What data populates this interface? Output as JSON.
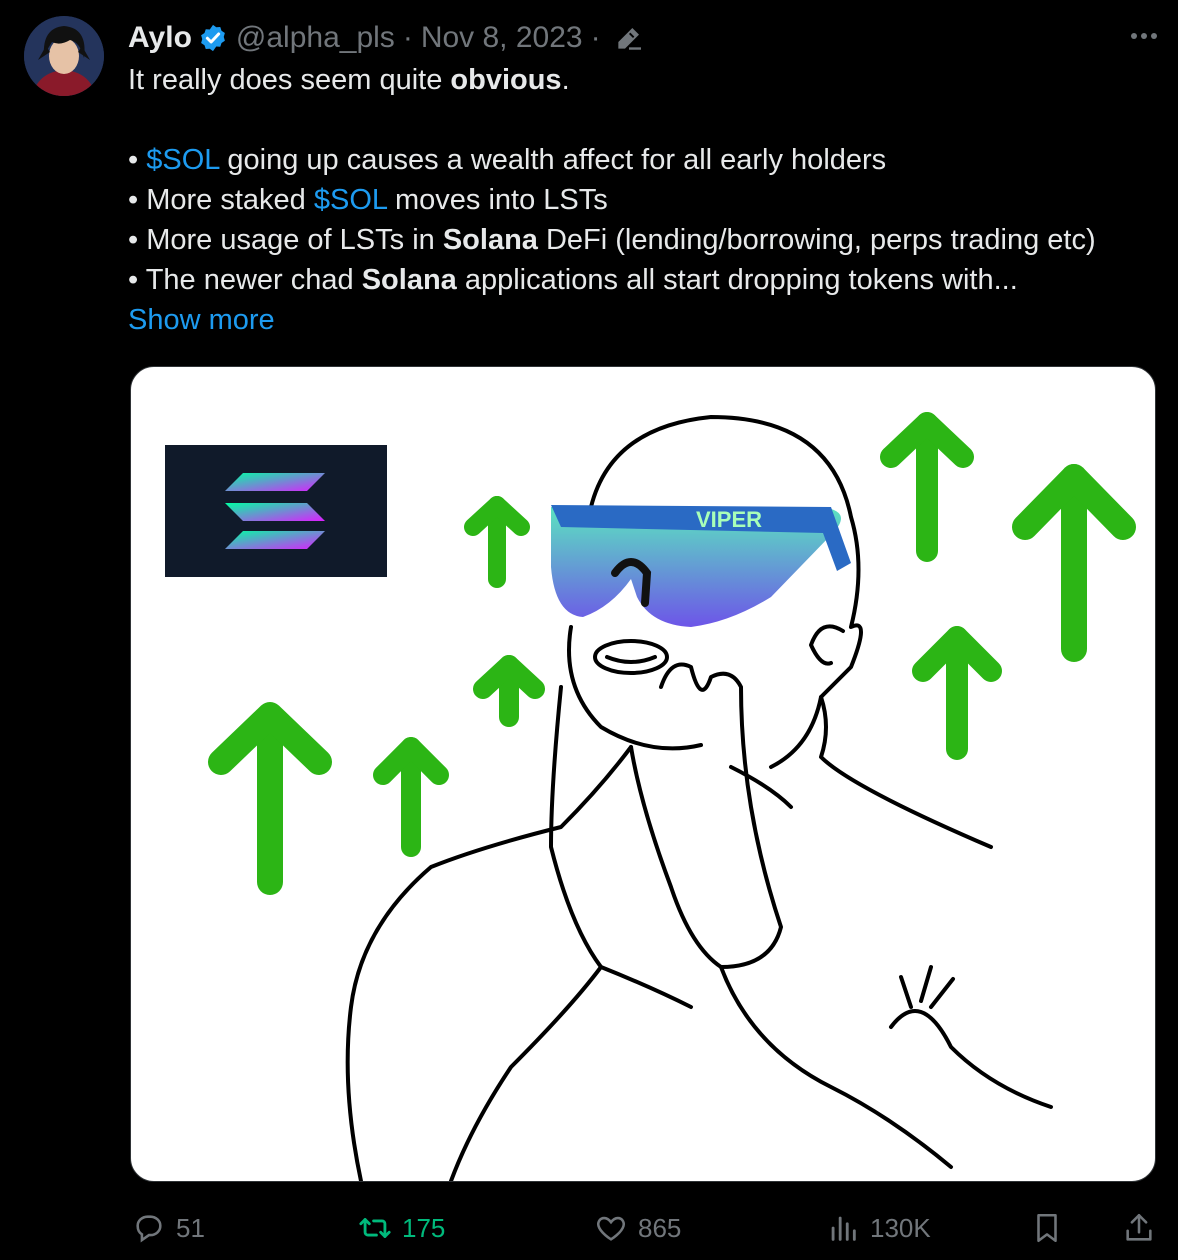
{
  "author": {
    "name": "Aylo",
    "handle": "@alpha_pls",
    "date": "Nov 8, 2023",
    "dot": "·"
  },
  "tweet": {
    "line1_prefix": "It really does seem quite ",
    "line1_bold": "obvious",
    "line1_suffix": ".",
    "bullets": [
      {
        "bullet": "• ",
        "link": "$SOL",
        "text": " going up causes a wealth affect for all early holders"
      },
      {
        "bullet": "• ",
        "prefix": "More staked ",
        "link": "$SOL",
        "text": " moves into LSTs"
      },
      {
        "bullet": "• ",
        "prefix": "More usage of LSTs in ",
        "bold": "Solana",
        "text": " DeFi (lending/borrowing, perps trading etc)"
      },
      {
        "bullet": "• ",
        "prefix": "The newer chad ",
        "bold": "Solana",
        "text": " applications all start dropping tokens with..."
      }
    ],
    "show_more": "Show more"
  },
  "media": {
    "glasses_text": "VIPER",
    "logo_colors": [
      "#00ffa3",
      "#9945ff"
    ],
    "arrow_color": "#2cb515"
  },
  "actions": {
    "replies": "51",
    "reposts": "175",
    "likes": "865",
    "views": "130K"
  },
  "colors": {
    "background": "#000000",
    "text": "#e7e9ea",
    "muted": "#71767b",
    "link": "#1d9bf0",
    "repost_active": "#00ba7c"
  }
}
